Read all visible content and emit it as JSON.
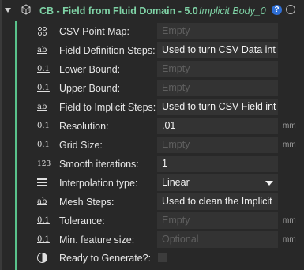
{
  "header": {
    "title": "CB - Field from Fluid Domain - 5.0",
    "subtitle": "Implicit Body_0",
    "help_glyph": "?",
    "icons": [
      "collapse-triangle-icon",
      "cube-icon",
      "help-icon",
      "status-circle-icon"
    ]
  },
  "accent_color": "#59c28b",
  "rows": {
    "csv_point_map": {
      "label": "CSV Point Map:",
      "icon": "point-map-icon",
      "value": "Empty",
      "is_placeholder": true
    },
    "field_definition_steps": {
      "label": "Field Definition Steps:",
      "icon_text": "ab",
      "value": "Used to turn CSV Data int"
    },
    "lower_bound": {
      "label": "Lower Bound:",
      "icon_text": "0.1",
      "value": "Empty",
      "is_placeholder": true
    },
    "upper_bound": {
      "label": "Upper Bound:",
      "icon_text": "0.1",
      "value": "Empty",
      "is_placeholder": true
    },
    "field_to_implicit_steps": {
      "label": "Field to Implicit Steps:",
      "icon_text": "ab",
      "value": "Used to turn CSV Field int"
    },
    "resolution": {
      "label": "Resolution:",
      "icon_text": "0.1",
      "value": ".01",
      "unit": "mm"
    },
    "grid_size": {
      "label": "Grid Size:",
      "icon_text": "0.1",
      "value": "Empty",
      "is_placeholder": true,
      "unit": "mm"
    },
    "smooth_iterations": {
      "label": "Smooth iterations:",
      "icon_text": "123",
      "value": "1"
    },
    "interpolation_type": {
      "label": "Interpolation type:",
      "icon": "list-icon",
      "value": "Linear"
    },
    "mesh_steps": {
      "label": "Mesh Steps:",
      "icon_text": "ab",
      "value": "Used to clean the Implicit"
    },
    "tolerance": {
      "label": "Tolerance:",
      "icon_text": "0.1",
      "value": "Empty",
      "is_placeholder": true,
      "unit": "mm"
    },
    "min_feature_size": {
      "label": "Min. feature size:",
      "icon_text": "0.1",
      "value": "Optional",
      "is_placeholder": true,
      "unit": "mm"
    },
    "ready_to_generate": {
      "label": "Ready to Generate?:",
      "icon": "half-circle-icon",
      "checked": false
    }
  }
}
